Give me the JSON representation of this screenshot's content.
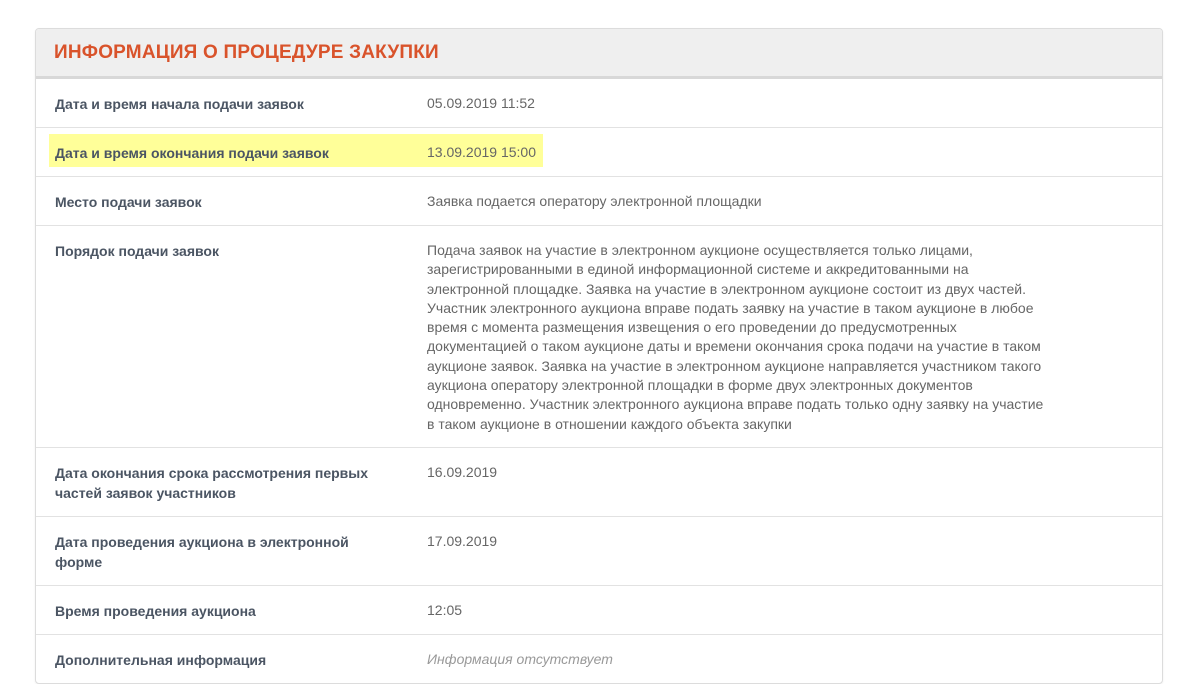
{
  "header": {
    "title": "ИНФОРМАЦИЯ О ПРОЦЕДУРЕ ЗАКУПКИ"
  },
  "rows": [
    {
      "label": "Дата и время начала подачи заявок",
      "value": "05.09.2019 11:52"
    },
    {
      "label": "Дата и время окончания подачи заявок",
      "value": "13.09.2019 15:00"
    },
    {
      "label": "Место подачи заявок",
      "value": "Заявка подается оператору электронной площадки"
    },
    {
      "label": "Порядок подачи заявок",
      "lines": [
        "Подача заявок на участие в электронном аукционе осуществляется только лицами,",
        "зарегистрированными в единой информационной системе и аккредитованными на",
        "электронной площадке. Заявка на участие в электронном аукционе состоит из двух частей.",
        "Участник электронного аукциона вправе подать заявку на участие в таком аукционе в любое",
        "время с момента размещения извещения о его проведении до предусмотренных",
        "документацией о таком аукционе даты и времени окончания срока подачи на участие в таком",
        "аукционе заявок. Заявка на участие в электронном аукционе направляется участником такого",
        "аукциона оператору электронной площадки в форме двух электронных документов",
        "одновременно. Участник электронного аукциона вправе подать только одну заявку на участие",
        "в таком аукционе в отношении каждого объекта закупки"
      ]
    },
    {
      "label_lines": [
        "Дата окончания срока рассмотрения первых",
        "частей заявок участников"
      ],
      "value": "16.09.2019"
    },
    {
      "label_lines": [
        "Дата проведения аукциона в электронной",
        "форме"
      ],
      "value": "17.09.2019"
    },
    {
      "label": "Время проведения аукциона",
      "value": "12:05"
    },
    {
      "label": "Дополнительная информация",
      "value": "Информация отсутствует"
    }
  ],
  "colors": {
    "title": "#d9532b",
    "highlight": "#ffff99"
  }
}
